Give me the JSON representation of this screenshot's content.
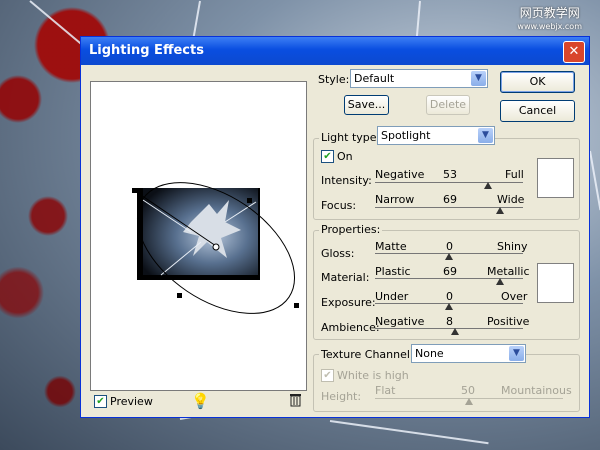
{
  "watermark": {
    "line1": "网页教学网",
    "line2": "www.webjx.com"
  },
  "dialog": {
    "title": "Lighting Effects"
  },
  "style": {
    "label": "Style:",
    "value": "Default",
    "save_label": "Save...",
    "delete_label": "Delete"
  },
  "buttons": {
    "ok": "OK",
    "cancel": "Cancel"
  },
  "light": {
    "type_label": "Light type:",
    "type_value": "Spotlight",
    "on_label": "On",
    "on_checked": true,
    "intensity": {
      "label": "Intensity:",
      "left": "Negative",
      "value": "53",
      "right": "Full",
      "fraction": 0.765
    },
    "focus": {
      "label": "Focus:",
      "left": "Narrow",
      "value": "69",
      "right": "Wide",
      "fraction": 0.845
    }
  },
  "properties": {
    "title": "Properties:",
    "gloss": {
      "label": "Gloss:",
      "left": "Matte",
      "value": "0",
      "right": "Shiny",
      "fraction": 0.5
    },
    "material": {
      "label": "Material:",
      "left": "Plastic",
      "value": "69",
      "right": "Metallic",
      "fraction": 0.845
    },
    "exposure": {
      "label": "Exposure:",
      "left": "Under",
      "value": "0",
      "right": "Over",
      "fraction": 0.5
    },
    "ambience": {
      "label": "Ambience:",
      "left": "Negative",
      "value": "8",
      "right": "Positive",
      "fraction": 0.54
    }
  },
  "texture": {
    "label": "Texture Channel:",
    "value": "None",
    "white_is_high": "White is high",
    "height": {
      "label": "Height:",
      "left": "Flat",
      "value": "50",
      "right": "Mountainous",
      "fraction": 0.5
    }
  },
  "preview": {
    "label": "Preview",
    "checked": true
  },
  "icons": {
    "light_bulb": "light-bulb-icon",
    "trash": "trash-icon"
  }
}
